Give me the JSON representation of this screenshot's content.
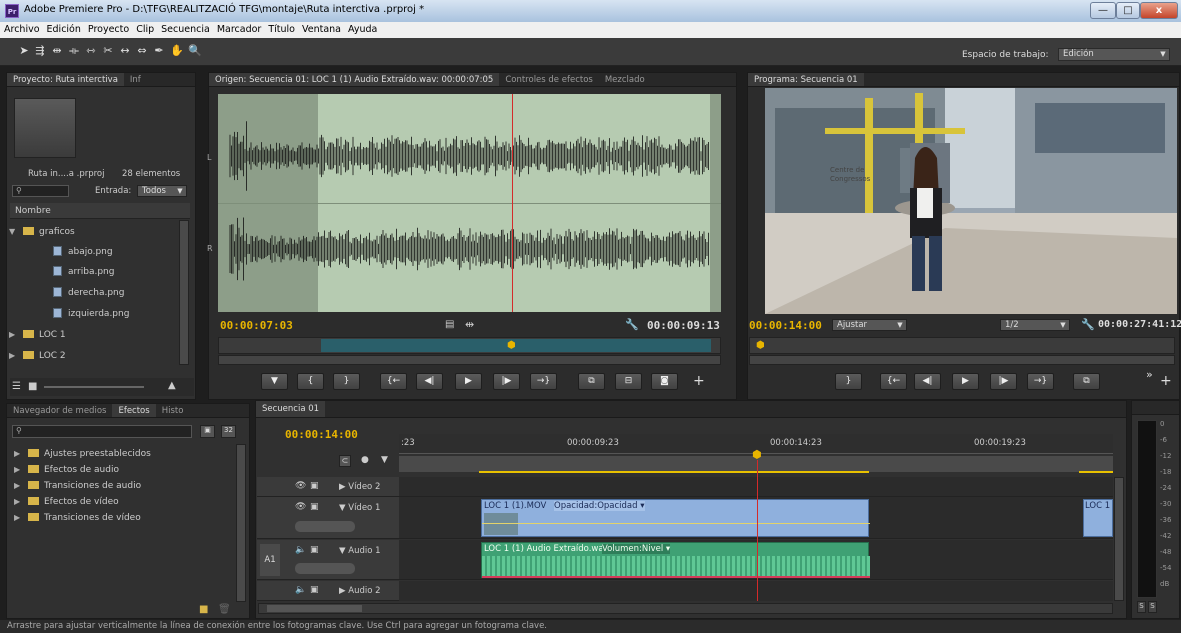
{
  "window": {
    "title": "Adobe Premiere Pro - D:\\TFG\\REALITZACIÓ TFG\\montaje\\Ruta interctiva .prproj *",
    "logo": "Pr",
    "controls": {
      "minimize": "—",
      "maximize": "□",
      "close": "x"
    }
  },
  "menu": [
    "Archivo",
    "Edición",
    "Proyecto",
    "Clip",
    "Secuencia",
    "Marcador",
    "Título",
    "Ventana",
    "Ayuda"
  ],
  "toolbar": {
    "tools": [
      "selection-tool",
      "track-select-tool",
      "ripple-edit-tool",
      "rolling-edit-tool",
      "rate-stretch-tool",
      "razor-tool",
      "slip-tool",
      "slide-tool",
      "pen-tool",
      "hand-tool",
      "zoom-tool"
    ],
    "workspace_label": "Espacio de trabajo:",
    "workspace_value": "Edición"
  },
  "project": {
    "tabs": [
      "Proyecto: Ruta interctiva",
      "Inf"
    ],
    "file_name": "Ruta in....a .prproj",
    "item_count": "28 elementos",
    "search_placeholder": "",
    "entrada_label": "Entrada:",
    "entrada_value": "Todos",
    "column_header": "Nombre",
    "items": [
      {
        "type": "folder",
        "label": "graficos",
        "expanded": true
      },
      {
        "type": "file",
        "label": "abajo.png"
      },
      {
        "type": "file",
        "label": "arriba.png"
      },
      {
        "type": "file",
        "label": "derecha.png"
      },
      {
        "type": "file",
        "label": "izquierda.png"
      },
      {
        "type": "folder",
        "label": "LOC 1",
        "expanded": false
      },
      {
        "type": "folder",
        "label": "LOC 2",
        "expanded": false
      }
    ]
  },
  "source_monitor": {
    "tabs": [
      "Origen: Secuencia 01: LOC 1 (1) Audio Extraído.wav: 00:00:07:05",
      "Controles de efectos",
      "Mezclado"
    ],
    "channel_labels": [
      "L",
      "R"
    ],
    "current_time": "00:00:07:03",
    "duration": "00:00:09:13",
    "playhead_fraction": 0.585
  },
  "program_monitor": {
    "tabs": [
      "Programa: Secuencia 01"
    ],
    "current_time": "00:00:14:00",
    "fit_label": "Ajustar",
    "resolution": "1/2",
    "duration": "00:00:27:41:12",
    "sign_text": "Centre de Congressos"
  },
  "effects": {
    "tabs": [
      "Navegador de medios",
      "Efectos",
      "Histo"
    ],
    "items": [
      "Ajustes preestablecidos",
      "Efectos de audio",
      "Transiciones de audio",
      "Efectos de vídeo",
      "Transiciones de vídeo"
    ],
    "badges": [
      "32"
    ]
  },
  "timeline": {
    "tab": "Secuencia 01",
    "current_time": "00:00:14:00",
    "ruler": [
      ":23",
      "00:00:09:23",
      "00:00:14:23",
      "00:00:19:23"
    ],
    "tracks": [
      {
        "id": "video2",
        "label": "Vídeo 2"
      },
      {
        "id": "video1",
        "label": "Vídeo 1"
      },
      {
        "id": "audio1",
        "label": "Audio 1",
        "target": "A1"
      },
      {
        "id": "audio2",
        "label": "Audio 2"
      }
    ],
    "video_clip": {
      "name": "LOC 1 (1).MOV",
      "fx": "Opacidad:Opacidad"
    },
    "video_clip_right": "LOC 1",
    "audio_clip": {
      "name": "LOC 1 (1) Audio Extraído.wav",
      "fx": "Volumen:Nivel"
    }
  },
  "meter": {
    "scale": [
      "0",
      "-6",
      "-12",
      "-18",
      "-24",
      "-30",
      "-36",
      "-42",
      "-48",
      "-54",
      "dB"
    ],
    "solo": [
      "S",
      "S"
    ]
  },
  "status": "Arrastre para ajustar verticalmente la línea de conexión entre los fotogramas clave. Use Ctrl para agregar un fotograma clave.",
  "colors": {
    "accent_timecode": "#e8b500",
    "playhead": "#d42a2a",
    "video_clip": "#8fb0dd",
    "audio_clip": "#3fa174",
    "waveform_bg": "#b6cbb1"
  }
}
